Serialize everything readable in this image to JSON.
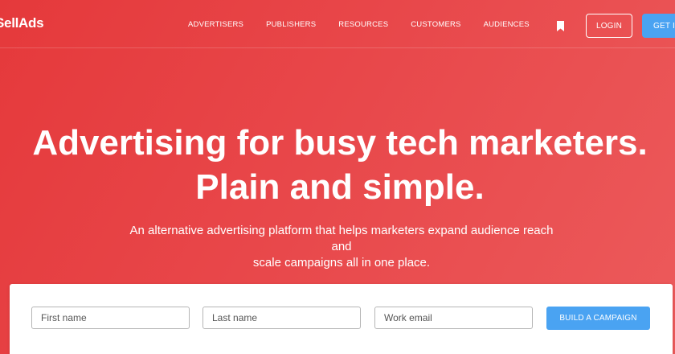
{
  "brand": {
    "logo_text": "SellAds"
  },
  "nav": {
    "items": [
      {
        "label": "ADVERTISERS"
      },
      {
        "label": "PUBLISHERS"
      },
      {
        "label": "RESOURCES"
      },
      {
        "label": "CUSTOMERS"
      },
      {
        "label": "AUDIENCES"
      }
    ],
    "bookmark_icon": "bookmark-icon",
    "login_label": "LOGIN",
    "cta_label": "GET IN"
  },
  "hero": {
    "headline_line1": "Advertising for busy tech marketers.",
    "headline_line2": "Plain and simple.",
    "subtext_line1": "An alternative advertising platform that helps marketers expand audience reach and",
    "subtext_line2": "scale campaigns all in one place."
  },
  "form": {
    "first_name_placeholder": "First name",
    "last_name_placeholder": "Last name",
    "email_placeholder": "Work email",
    "submit_label": "BUILD A CAMPAIGN"
  },
  "colors": {
    "hero_red": "#e5393b",
    "button_blue": "#4aa3f2"
  }
}
